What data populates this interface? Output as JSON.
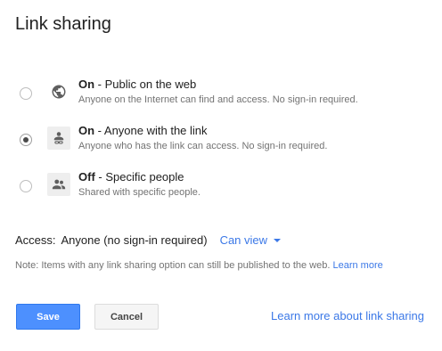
{
  "dialog": {
    "title": "Link sharing"
  },
  "options": [
    {
      "state": "On",
      "separator": " - ",
      "label": "Public on the web",
      "description": "Anyone on the Internet can find and access. No sign-in required.",
      "icon": "globe-icon",
      "selected": false
    },
    {
      "state": "On",
      "separator": " - ",
      "label": "Anyone with the link",
      "description": "Anyone who has the link can access. No sign-in required.",
      "icon": "person-link-icon",
      "selected": true
    },
    {
      "state": "Off",
      "separator": " - ",
      "label": "Specific people",
      "description": "Shared with specific people.",
      "icon": "people-icon",
      "selected": false
    }
  ],
  "access": {
    "label": "Access:",
    "value": "Anyone (no sign-in required)",
    "permission": "Can view"
  },
  "note": {
    "text": "Note: Items with any link sharing option can still be published to the web.",
    "link": "Learn more"
  },
  "buttons": {
    "save": "Save",
    "cancel": "Cancel"
  },
  "footer": {
    "learn_more_link": "Learn more about link sharing"
  },
  "colors": {
    "primary": "#4d90fe",
    "link": "#3b78e7",
    "muted_text": "#737373"
  }
}
